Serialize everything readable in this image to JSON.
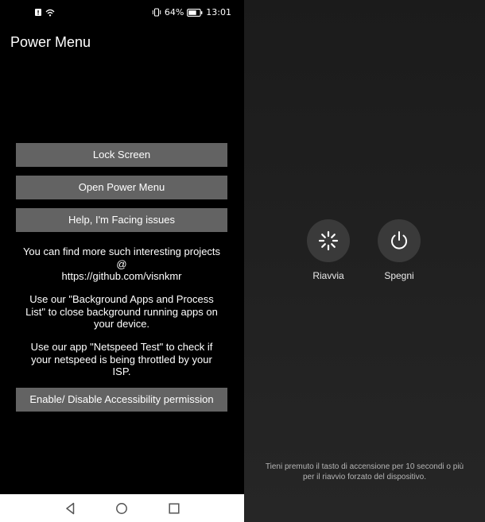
{
  "status_bar": {
    "battery_percent": "64%",
    "time": "13:01"
  },
  "app": {
    "title": "Power Menu"
  },
  "buttons": {
    "lock_screen": "Lock Screen",
    "open_power_menu": "Open Power Menu",
    "help": "Help, I'm Facing issues",
    "accessibility": "Enable/ Disable Accessibility permission"
  },
  "info": {
    "projects_line1": "You can find more such interesting projects",
    "projects_line2": "@",
    "projects_line3": "https://github.com/visnkmr",
    "bg_apps_line1": "Use our \"Background Apps and Process",
    "bg_apps_line2": "List\" to close background running apps on",
    "bg_apps_line3": "your device.",
    "netspeed_line1": "Use our app \"Netspeed Test\" to check if",
    "netspeed_line2": "your netspeed is being throttled by your",
    "netspeed_line3": "ISP."
  },
  "power_menu": {
    "restart_label": "Riavvia",
    "shutdown_label": "Spegni",
    "hint_line1": "Tieni premuto il tasto di accensione per 10 secondi o più",
    "hint_line2": "per il riavvio forzato del dispositivo."
  },
  "icons": {
    "back": "back-icon",
    "home": "home-icon",
    "recent": "recent-apps-icon",
    "restart": "restart-spinner-icon",
    "shutdown": "power-icon"
  },
  "colors": {
    "button_bg": "#636363",
    "navbar_bg": "#ffffff",
    "power_button_bg": "#3a3a3a"
  }
}
